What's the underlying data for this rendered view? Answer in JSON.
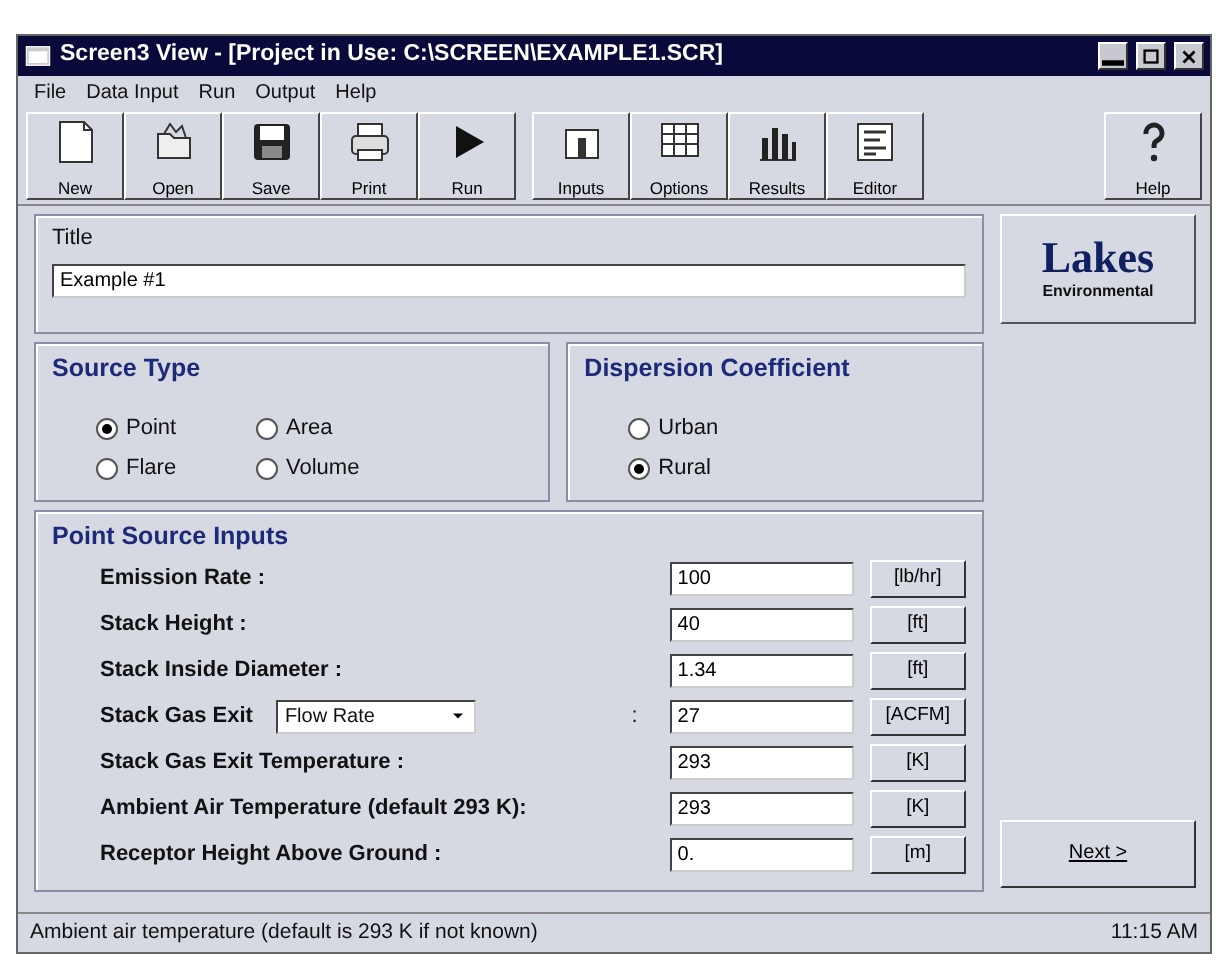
{
  "window": {
    "title": "Screen3 View - [Project in Use: C:\\SCREEN\\EXAMPLE1.SCR]"
  },
  "menu": [
    "File",
    "Data Input",
    "Run",
    "Output",
    "Help"
  ],
  "toolbar": [
    {
      "kind": "new",
      "label": "New"
    },
    {
      "kind": "open",
      "label": "Open"
    },
    {
      "kind": "save",
      "label": "Save"
    },
    {
      "kind": "print",
      "label": "Print"
    },
    {
      "kind": "run",
      "label": "Run"
    },
    {
      "kind": "inputs",
      "label": "Inputs"
    },
    {
      "kind": "options",
      "label": "Options"
    },
    {
      "kind": "results",
      "label": "Results"
    },
    {
      "kind": "editor",
      "label": "Editor"
    },
    {
      "kind": "help",
      "label": "Help"
    }
  ],
  "title_group": {
    "label": "Title",
    "value": "Example #1"
  },
  "logo": {
    "name": "Lakes",
    "subtitle": "Environmental"
  },
  "source_type": {
    "heading": "Source Type",
    "options": [
      {
        "label": "Point",
        "selected": true
      },
      {
        "label": "Area",
        "selected": false
      },
      {
        "label": "Flare",
        "selected": false
      },
      {
        "label": "Volume",
        "selected": false
      }
    ]
  },
  "dispersion_coefficient": {
    "heading": "Dispersion Coefficient",
    "options": [
      {
        "label": "Urban",
        "selected": false
      },
      {
        "label": "Rural",
        "selected": true
      }
    ]
  },
  "point_source_inputs": {
    "heading": "Point Source Inputs",
    "rows": [
      {
        "kind": "field",
        "label": "Emission Rate :",
        "value": "100",
        "unit": "[lb/hr]"
      },
      {
        "kind": "field",
        "label": "Stack Height :",
        "value": "40",
        "unit": "[ft]"
      },
      {
        "kind": "field",
        "label": "Stack Inside Diameter :",
        "value": "1.34",
        "unit": "[ft]"
      },
      {
        "kind": "select",
        "label": "Stack Gas Exit",
        "choice": "Flow Rate",
        "separator": ":",
        "value": "27",
        "unit": "[ACFM]"
      },
      {
        "kind": "field",
        "label": "Stack Gas Exit Temperature :",
        "value": "293",
        "unit": "[K]"
      },
      {
        "kind": "field",
        "label": "Ambient Air Temperature (default 293 K):",
        "value": "293",
        "unit": "[K]"
      },
      {
        "kind": "field",
        "label": "Receptor Height Above Ground :",
        "value": "0.",
        "unit": "[m]"
      }
    ]
  },
  "next_button": "Next >",
  "status_bar": {
    "message": "Ambient air temperature (default is 293 K if not known)",
    "time": "11:15 AM"
  }
}
